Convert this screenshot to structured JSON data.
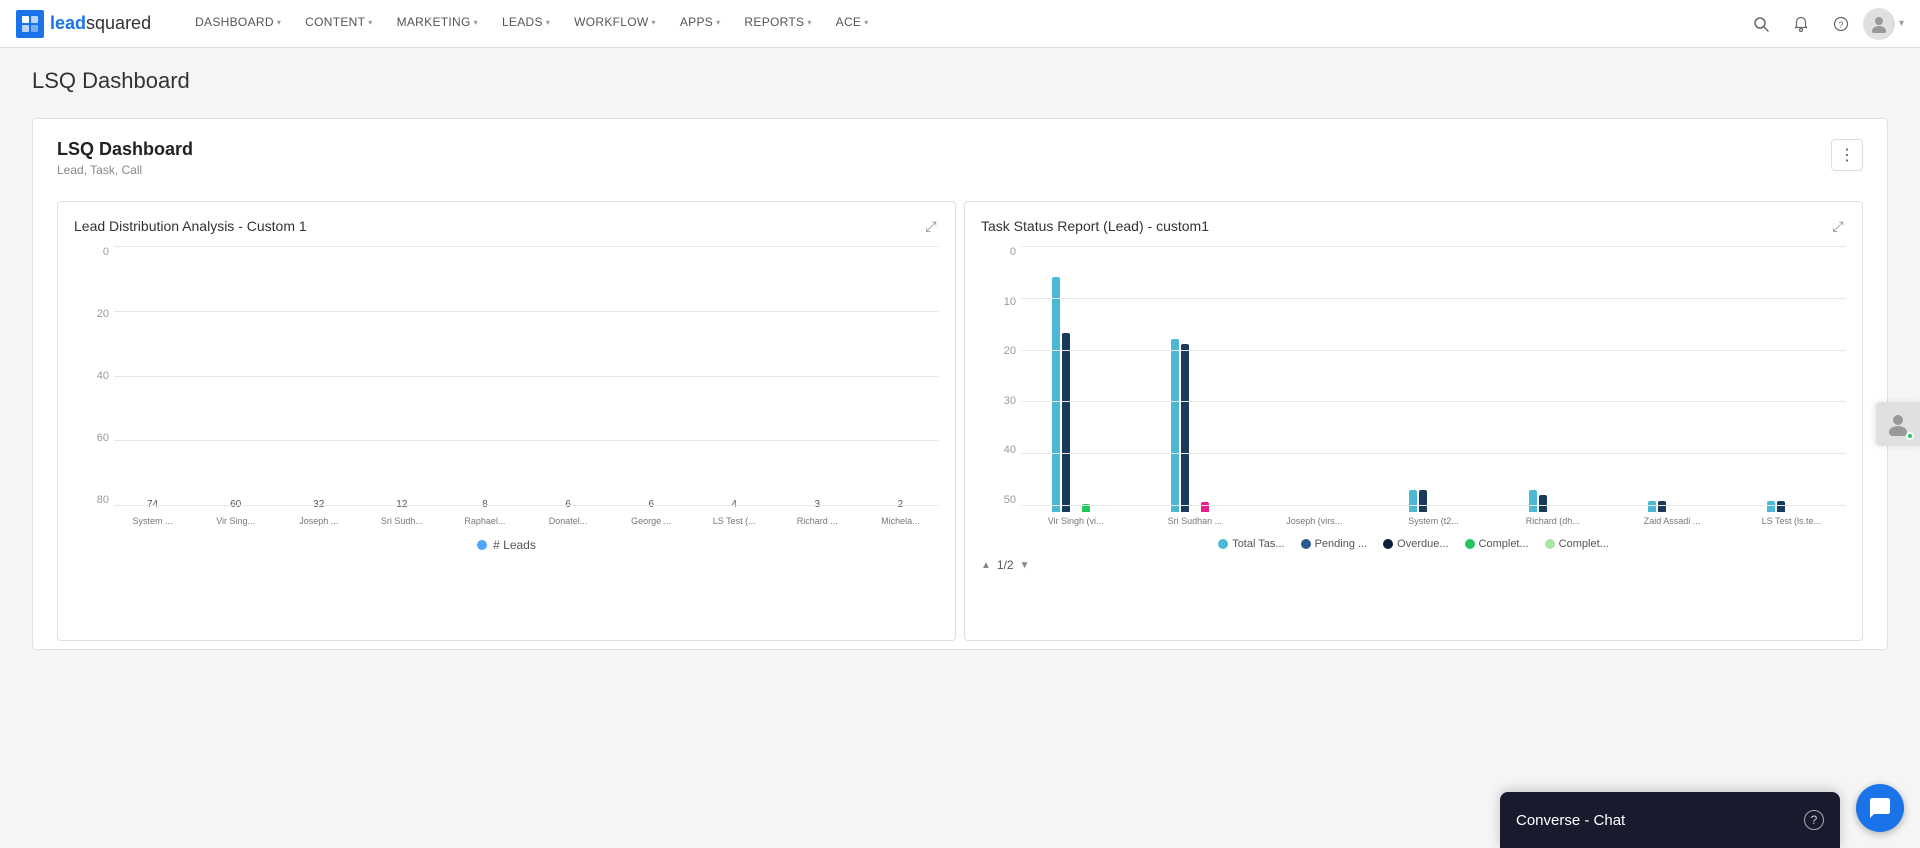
{
  "brand": {
    "name_prefix": "lead",
    "name_suffix": "squared"
  },
  "navbar": {
    "items": [
      {
        "label": "DASHBOARD",
        "has_chevron": true
      },
      {
        "label": "CONTENT",
        "has_chevron": true
      },
      {
        "label": "MARKETING",
        "has_chevron": true
      },
      {
        "label": "LEADS",
        "has_chevron": true
      },
      {
        "label": "WORKFLOW",
        "has_chevron": true
      },
      {
        "label": "APPS",
        "has_chevron": true
      },
      {
        "label": "REPORTS",
        "has_chevron": true
      },
      {
        "label": "ACE",
        "has_chevron": true
      }
    ]
  },
  "page": {
    "title": "LSQ Dashboard"
  },
  "dashboard": {
    "title": "LSQ Dashboard",
    "subtitle": "Lead, Task, Call",
    "menu_icon": "⋮"
  },
  "chart_left": {
    "title": "Lead Distribution Analysis - Custom 1",
    "expand_icon": "⤢",
    "y_labels": [
      "0",
      "20",
      "40",
      "60",
      "80"
    ],
    "bars": [
      {
        "label": "System ...",
        "value": 74,
        "height_pct": 93
      },
      {
        "label": "Vir Sing...",
        "value": 60,
        "height_pct": 75
      },
      {
        "label": "Joseph ...",
        "value": 32,
        "height_pct": 40
      },
      {
        "label": "Sri Sudh...",
        "value": 12,
        "height_pct": 15
      },
      {
        "label": "Raphael...",
        "value": 8,
        "height_pct": 10
      },
      {
        "label": "Donatel...",
        "value": 6,
        "height_pct": 7.5
      },
      {
        "label": "George ...",
        "value": 6,
        "height_pct": 7.5
      },
      {
        "label": "LS Test (...",
        "value": 4,
        "height_pct": 5
      },
      {
        "label": "Richard ...",
        "value": 3,
        "height_pct": 3.7
      },
      {
        "label": "Michela...",
        "value": 2,
        "height_pct": 2.5
      }
    ],
    "legend": "# Leads"
  },
  "chart_right": {
    "title": "Task Status Report (Lead) - custom1",
    "expand_icon": "⤢",
    "y_labels": [
      "0",
      "10",
      "20",
      "30",
      "40",
      "50"
    ],
    "groups": [
      {
        "label": "Vir Singh (vi...",
        "bars": [
          {
            "color": "#4db8d4",
            "height_pct": 84
          },
          {
            "color": "#1a3a5c",
            "height_pct": 64
          },
          {
            "color": "#0a1f3c",
            "height_pct": 0
          },
          {
            "color": "#22c55e",
            "height_pct": 0
          },
          {
            "color": "#a8e6a3",
            "height_pct": 3
          }
        ]
      },
      {
        "label": "Sri Sudhan ...",
        "bars": [
          {
            "color": "#4db8d4",
            "height_pct": 62
          },
          {
            "color": "#1a3a5c",
            "height_pct": 60
          },
          {
            "color": "#0a1f3c",
            "height_pct": 0
          },
          {
            "color": "#e91e8c",
            "height_pct": 4
          },
          {
            "color": "#a8e6a3",
            "height_pct": 0
          }
        ]
      },
      {
        "label": "Joseph (virs...",
        "bars": [
          {
            "color": "#4db8d4",
            "height_pct": 0
          },
          {
            "color": "#1a3a5c",
            "height_pct": 0
          },
          {
            "color": "#0a1f3c",
            "height_pct": 0
          },
          {
            "color": "#22c55e",
            "height_pct": 0
          },
          {
            "color": "#a8e6a3",
            "height_pct": 0
          }
        ]
      },
      {
        "label": "System (t2...",
        "bars": [
          {
            "color": "#4db8d4",
            "height_pct": 8
          },
          {
            "color": "#1a3a5c",
            "height_pct": 8
          },
          {
            "color": "#0a1f3c",
            "height_pct": 0
          },
          {
            "color": "#22c55e",
            "height_pct": 0
          },
          {
            "color": "#a8e6a3",
            "height_pct": 0
          }
        ]
      },
      {
        "label": "Richard (dh...",
        "bars": [
          {
            "color": "#4db8d4",
            "height_pct": 8
          },
          {
            "color": "#1a3a5c",
            "height_pct": 6
          },
          {
            "color": "#0a1f3c",
            "height_pct": 0
          },
          {
            "color": "#22c55e",
            "height_pct": 0
          },
          {
            "color": "#a8e6a3",
            "height_pct": 0
          }
        ]
      },
      {
        "label": "Zaid Assadi ...",
        "bars": [
          {
            "color": "#4db8d4",
            "height_pct": 4
          },
          {
            "color": "#1a3a5c",
            "height_pct": 4
          },
          {
            "color": "#0a1f3c",
            "height_pct": 0
          },
          {
            "color": "#22c55e",
            "height_pct": 0
          },
          {
            "color": "#a8e6a3",
            "height_pct": 0
          }
        ]
      },
      {
        "label": "LS Test (ls.te...",
        "bars": [
          {
            "color": "#4db8d4",
            "height_pct": 4
          },
          {
            "color": "#1a3a5c",
            "height_pct": 4
          },
          {
            "color": "#0a1f3c",
            "height_pct": 0
          },
          {
            "color": "#22c55e",
            "height_pct": 0
          },
          {
            "color": "#a8e6a3",
            "height_pct": 0
          }
        ]
      }
    ],
    "legend": [
      {
        "label": "Total Tas...",
        "color": "#4db8d4",
        "type": "circle"
      },
      {
        "label": "Pending ...",
        "color": "#2a5a8c",
        "type": "circle"
      },
      {
        "label": "Overdue...",
        "color": "#0a1f3c",
        "type": "circle"
      },
      {
        "label": "Complet...",
        "color": "#22c55e",
        "type": "circle"
      },
      {
        "label": "Complet...",
        "color": "#a8e6a3",
        "type": "circle"
      }
    ],
    "pagination": "1/2"
  },
  "converse": {
    "title": "Converse - Chat",
    "help_icon": "?",
    "chat_icon": "💬"
  }
}
